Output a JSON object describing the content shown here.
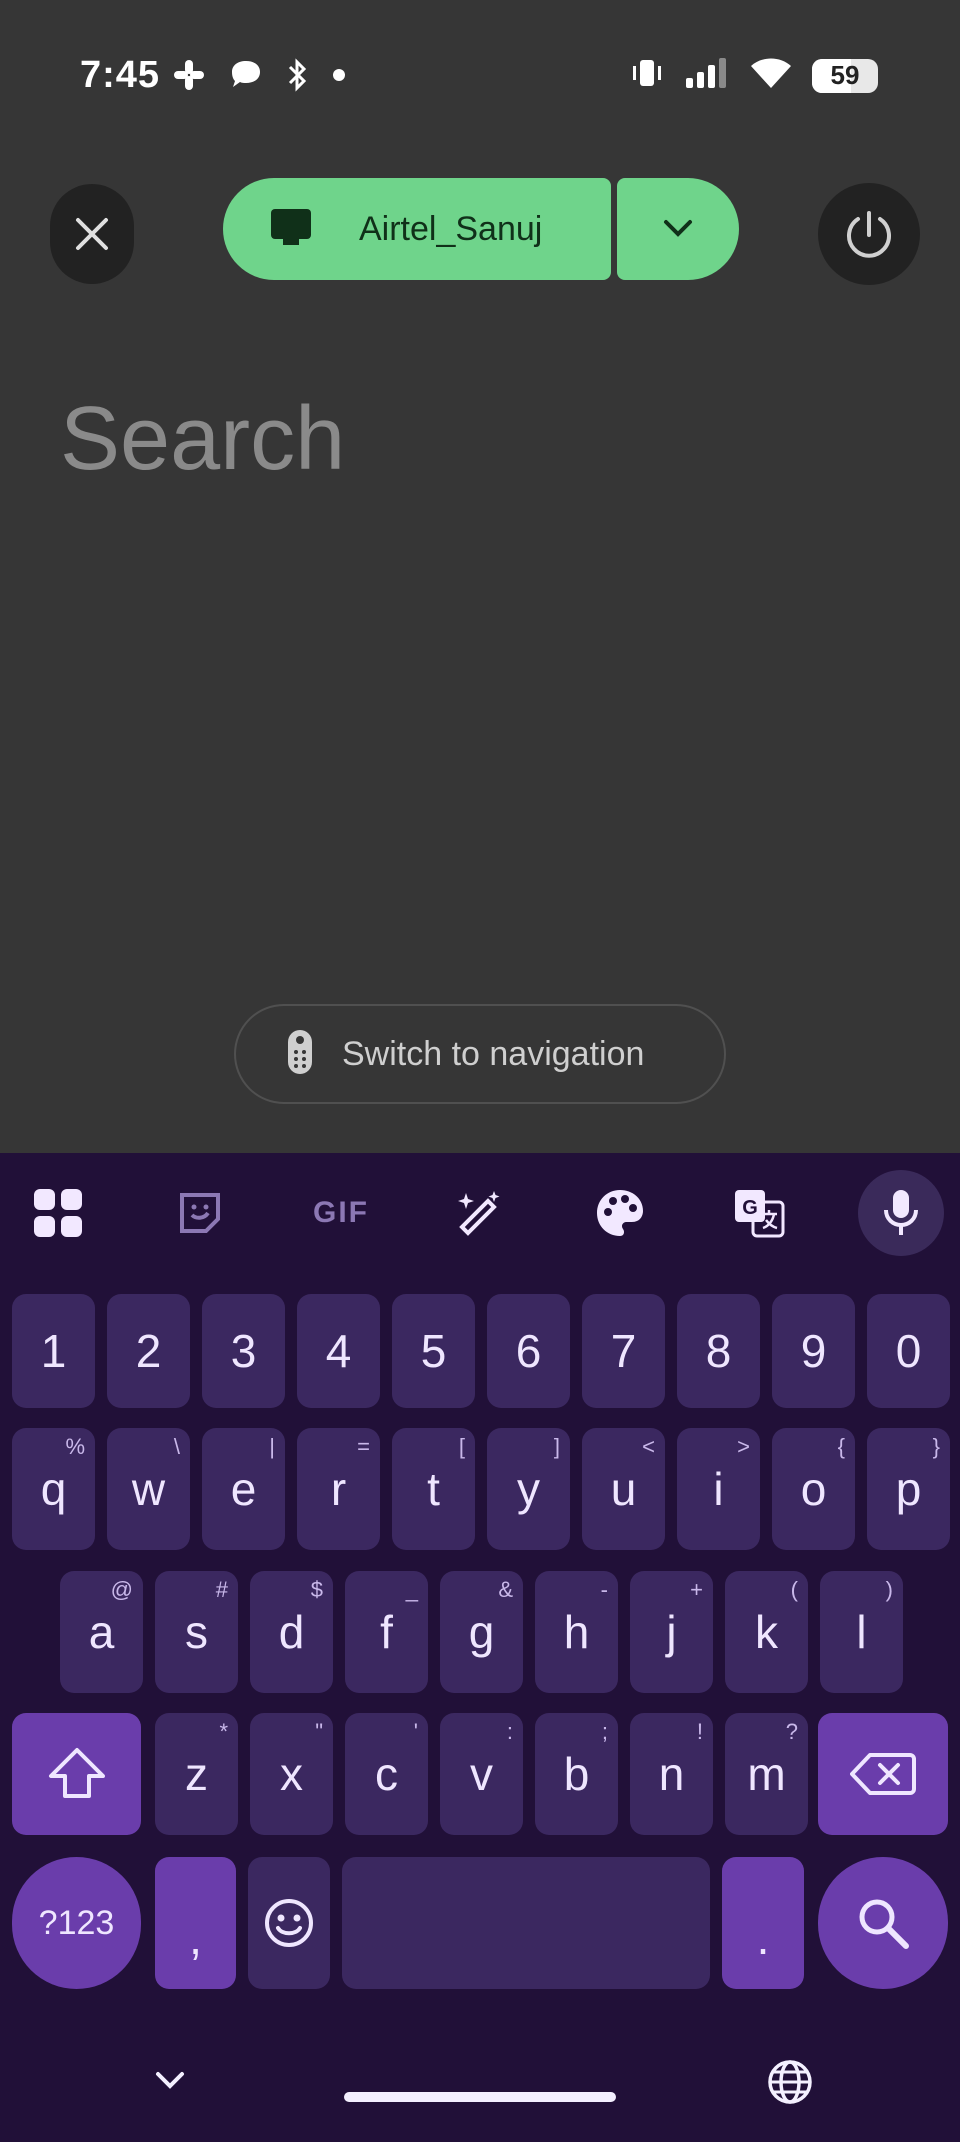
{
  "status_bar": {
    "time": "7:45",
    "battery": "59",
    "icons_left": [
      "slack-icon",
      "chat-bubble-icon",
      "bluetooth-icon",
      "dot-icon"
    ],
    "icons_right": [
      "vibrate-icon",
      "signal-icon",
      "wifi-icon",
      "battery-icon"
    ]
  },
  "header": {
    "device_name": "Airtel_Sanuj",
    "accent": "#6fd48b"
  },
  "search": {
    "placeholder": "Search"
  },
  "switch_nav": {
    "label": "Switch to navigation"
  },
  "keyboard": {
    "toolbar": [
      "apps-grid-icon",
      "sticker-icon",
      "GIF",
      "magic-pen-icon",
      "palette-icon",
      "translate-icon",
      "mic-icon"
    ],
    "gif_label": "GIF",
    "translate_label": "G",
    "number_row": [
      "1",
      "2",
      "3",
      "4",
      "5",
      "6",
      "7",
      "8",
      "9",
      "0"
    ],
    "row1": [
      {
        "key": "q",
        "hint": "%"
      },
      {
        "key": "w",
        "hint": "\\"
      },
      {
        "key": "e",
        "hint": "|"
      },
      {
        "key": "r",
        "hint": "="
      },
      {
        "key": "t",
        "hint": "["
      },
      {
        "key": "y",
        "hint": "]"
      },
      {
        "key": "u",
        "hint": "<"
      },
      {
        "key": "i",
        "hint": ">"
      },
      {
        "key": "o",
        "hint": "{"
      },
      {
        "key": "p",
        "hint": "}"
      }
    ],
    "row2": [
      {
        "key": "a",
        "hint": "@"
      },
      {
        "key": "s",
        "hint": "#"
      },
      {
        "key": "d",
        "hint": "$"
      },
      {
        "key": "f",
        "hint": "_"
      },
      {
        "key": "g",
        "hint": "&"
      },
      {
        "key": "h",
        "hint": "-"
      },
      {
        "key": "j",
        "hint": "+"
      },
      {
        "key": "k",
        "hint": "("
      },
      {
        "key": "l",
        "hint": ")"
      }
    ],
    "row3": [
      {
        "key": "z",
        "hint": "*"
      },
      {
        "key": "x",
        "hint": "\""
      },
      {
        "key": "c",
        "hint": "'"
      },
      {
        "key": "v",
        "hint": ":"
      },
      {
        "key": "b",
        "hint": ";"
      },
      {
        "key": "n",
        "hint": "!"
      },
      {
        "key": "m",
        "hint": "?"
      }
    ],
    "symbols_label": "?123",
    "comma": ",",
    "period": ".",
    "key_bg": "#3b2860",
    "accent_key_bg": "#6a3dab",
    "bg": "#211038"
  }
}
